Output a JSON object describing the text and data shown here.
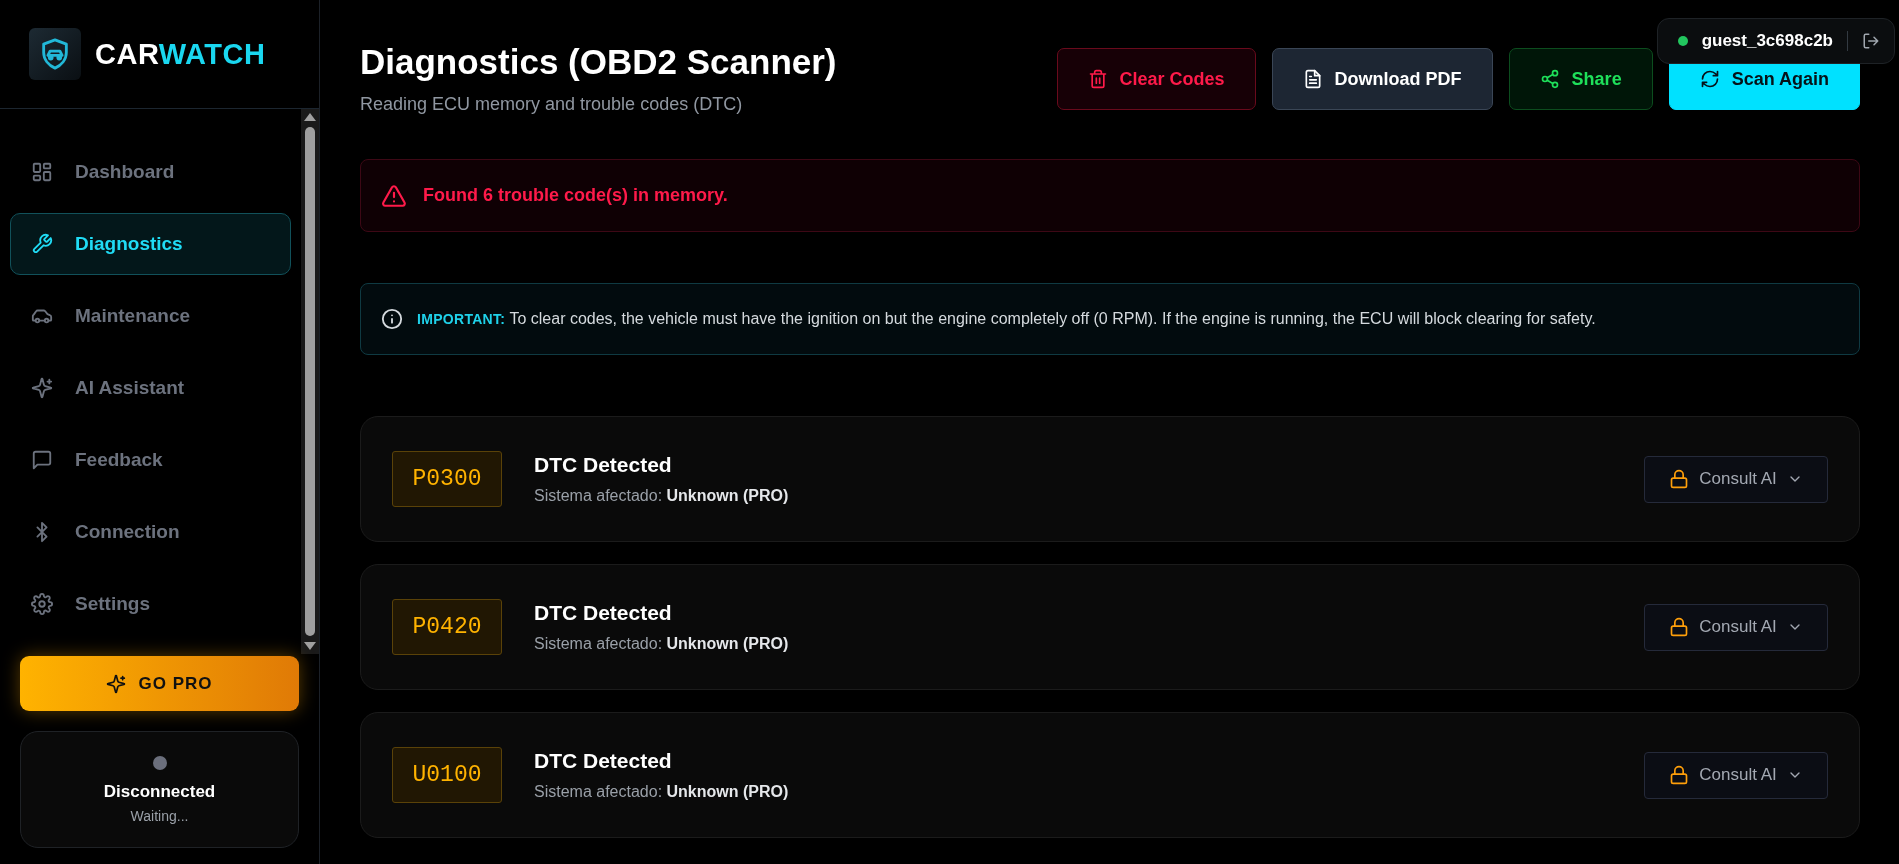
{
  "brand": {
    "part_1": "CAR",
    "part_2": "WATCH"
  },
  "sidebar": {
    "items": [
      {
        "label": "Dashboard",
        "selected": false
      },
      {
        "label": "Diagnostics",
        "selected": true
      },
      {
        "label": "Maintenance",
        "selected": false
      },
      {
        "label": "AI Assistant",
        "selected": false
      },
      {
        "label": "Feedback",
        "selected": false
      },
      {
        "label": "Connection",
        "selected": false
      },
      {
        "label": "Settings",
        "selected": false
      }
    ],
    "go_pro": "GO PRO",
    "connection": {
      "connected": false,
      "status": "Disconnected",
      "detail": "Waiting..."
    }
  },
  "user": {
    "name": "guest_3c698c2b",
    "online": true
  },
  "header": {
    "title": "Diagnostics (OBD2 Scanner)",
    "subtitle": "Reading ECU memory and trouble codes (DTC)"
  },
  "actions": [
    {
      "label": "Clear Codes",
      "kind": "danger"
    },
    {
      "label": "Download PDF",
      "kind": "neutral"
    },
    {
      "label": "Share",
      "kind": "success"
    },
    {
      "label": "Scan Again",
      "kind": "primary"
    }
  ],
  "alert": {
    "text": "Found 6 trouble code(s) in memory."
  },
  "notice": {
    "text": "**IMPORTANT:** To clear codes, the vehicle must have the ignition on but the engine completely off (0 RPM). If the engine is running, the ECU will block clearing for safety."
  },
  "codes": [
    {
      "code": "P0300",
      "title": "DTC Detected",
      "system": "Sistema afectado: **Unknown (PRO)**",
      "action": "Consult AI"
    },
    {
      "code": "P0420",
      "title": "DTC Detected",
      "system": "Sistema afectado: **Unknown (PRO)**",
      "action": "Consult AI"
    },
    {
      "code": "U0100",
      "title": "DTC Detected",
      "system": "Sistema afectado: **Unknown (PRO)**",
      "action": "Consult AI"
    }
  ]
}
